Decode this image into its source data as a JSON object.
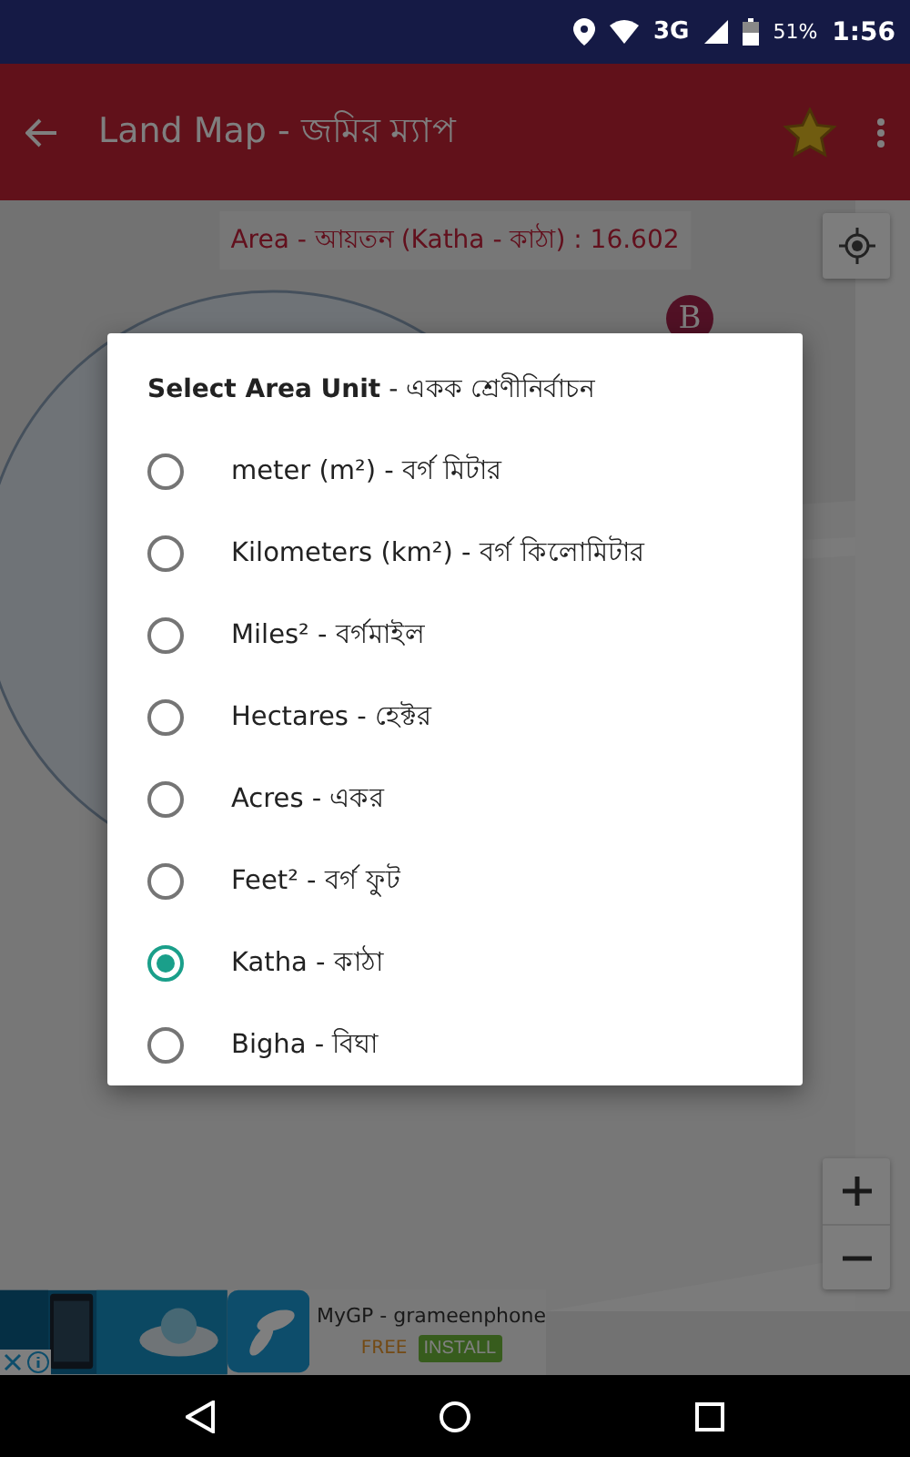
{
  "status_bar": {
    "network": "3G",
    "battery": "51%",
    "time": "1:56"
  },
  "toolbar": {
    "title": "Land Map - জমির ম্যাপ",
    "favorite": true
  },
  "map": {
    "area_label": "Area - আয়তন (Katha - কাঠা) : 16.602",
    "marker": "B"
  },
  "dialog": {
    "title": "**Select Area Unit** - একক শ্রেণীনির্বাচন",
    "options": [
      {
        "label": "meter (m²) - বর্গ মিটার",
        "selected": false
      },
      {
        "label": "Kilometers (km²) - বর্গ কিলোমিটার",
        "selected": false
      },
      {
        "label": "Miles² - বর্গমাইল",
        "selected": false
      },
      {
        "label": "Hectares - হেক্টর",
        "selected": false
      },
      {
        "label": "Acres - একর",
        "selected": false
      },
      {
        "label": "Feet² - বর্গ ফুট",
        "selected": false
      },
      {
        "label": "Katha - কাঠা",
        "selected": true
      },
      {
        "label": "Bigha - বিঘা",
        "selected": false
      }
    ]
  },
  "ad": {
    "app_name": "MyGP - grameenphone",
    "price": "FREE",
    "install": "INSTALL"
  }
}
